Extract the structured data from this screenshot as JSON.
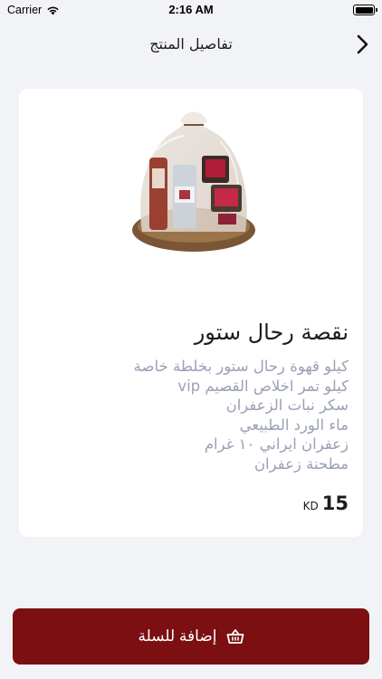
{
  "status_bar": {
    "carrier": "Carrier",
    "time": "2:16 AM",
    "icons": [
      "wifi-icon",
      "battery-icon"
    ]
  },
  "nav": {
    "title": "تفاصيل المنتج",
    "back_icon": "chevron-right-icon"
  },
  "product": {
    "image_alt": "gift-basket-image",
    "title": "نقصة رحال ستور",
    "description": [
      "كيلو قهوة رحال ستور بخلطة خاصة",
      "كيلو تمر اخلاص القصيم vip",
      "سكر نبات الزعفران",
      "ماء الورد الطبيعي",
      "زعفران ايراني ١٠ غرام",
      "مطحنة زعفران"
    ],
    "price_amount": "15",
    "price_currency": "KD"
  },
  "cart_button": {
    "label": "إضافة للسلة",
    "icon": "basket-icon"
  },
  "colors": {
    "background": "#f2f3f7",
    "card": "#ffffff",
    "accent": "#7b0f12",
    "description_text": "#9aa1b7"
  }
}
